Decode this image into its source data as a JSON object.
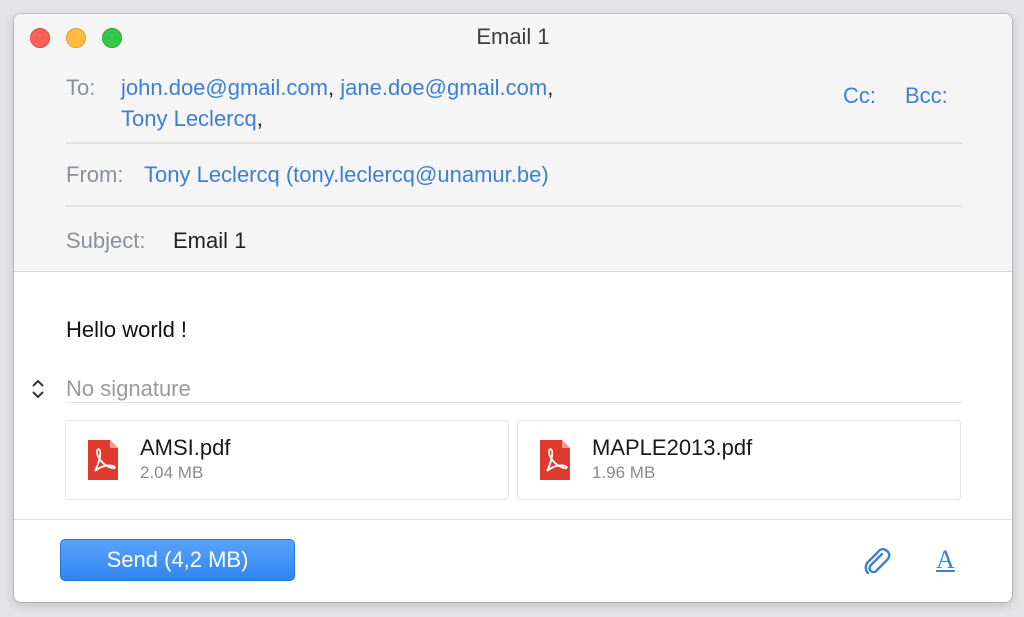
{
  "window": {
    "title": "Email 1"
  },
  "header": {
    "to_label": "To:",
    "recipients": [
      "john.doe@gmail.com",
      "jane.doe@gmail.com",
      "Tony Leclercq"
    ],
    "cc_label": "Cc:",
    "bcc_label": "Bcc:",
    "from_label": "From:",
    "from_value": "Tony Leclercq (tony.leclercq@unamur.be)",
    "subject_label": "Subject:",
    "subject_value": "Email 1"
  },
  "body": {
    "text": "Hello world !",
    "signature": "No signature"
  },
  "attachments": [
    {
      "name": "AMSI.pdf",
      "size": "2.04 MB",
      "icon": "pdf-icon"
    },
    {
      "name": "MAPLE2013.pdf",
      "size": "1.96 MB",
      "icon": "pdf-icon"
    }
  ],
  "footer": {
    "send_label": "Send (4,2 MB)",
    "attach_icon": "paperclip-icon",
    "format_label": "A"
  },
  "colors": {
    "link": "#3c7fd6",
    "send_button": "#3a8cf5",
    "pdf_red": "#e03a2f"
  }
}
